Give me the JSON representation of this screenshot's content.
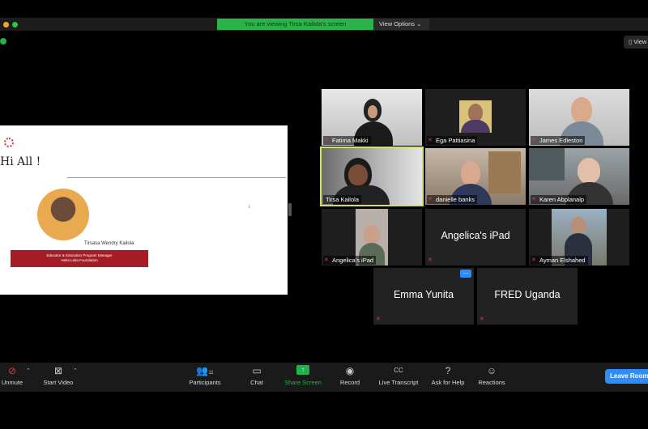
{
  "banner": {
    "viewing_text": "You are viewing Tirsa Kailola's screen",
    "view_options": "View Options ⌄"
  },
  "view_button": "View",
  "slide": {
    "title": "Hi All !",
    "presenter_name": "Tirsasa Wendry Kailola",
    "role_line1": "Educator & Education Program Manager",
    "role_line2": "Heka Leka Foundation"
  },
  "participants": [
    {
      "name": "Fatima Makki",
      "muted": true
    },
    {
      "name": "Ega Pattiasina",
      "muted": true
    },
    {
      "name": "James Edleston",
      "muted": true
    },
    {
      "name": "Tirsa Kailola",
      "muted": false,
      "active": true
    },
    {
      "name": "danielle banks",
      "muted": true
    },
    {
      "name": "Karen Abplanalp",
      "muted": true
    },
    {
      "name": "Angelica's iPad",
      "muted": true
    },
    {
      "name": "Angelica's iPad",
      "muted": true,
      "video": false
    },
    {
      "name": "Ayman Elshahed",
      "muted": true
    },
    {
      "name": "Emma Yunita",
      "muted": true,
      "video": false
    },
    {
      "name": "FRED Uganda",
      "muted": true,
      "video": false
    }
  ],
  "toolbar": {
    "unmute": "Unmute",
    "start_video": "Start Video",
    "participants": "Participants",
    "participant_count": "11",
    "chat": "Chat",
    "share_screen": "Share Screen",
    "record": "Record",
    "live_transcript": "Live Transcript",
    "ask_for_help": "Ask for Help",
    "reactions": "Reactions",
    "leave_room": "Leave Room"
  },
  "colors": {
    "share_green": "#23b14d",
    "leave_blue": "#2d8cff",
    "active_speaker": "#d6e05a",
    "slide_banner": "#a51c24"
  }
}
